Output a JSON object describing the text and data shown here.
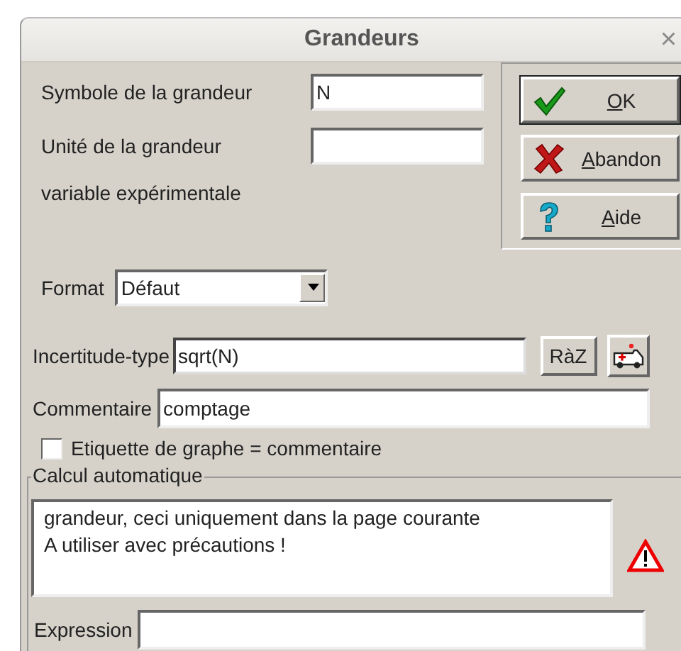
{
  "window": {
    "title": "Grandeurs",
    "close": "×"
  },
  "symbol": {
    "label": "Symbole de la grandeur",
    "value": "N"
  },
  "unit": {
    "label": "Unité de la grandeur"
  },
  "variable_kind": "variable expérimentale",
  "buttons": [
    {
      "kind": "ok",
      "key": "O",
      "rest": "K",
      "default": true
    },
    {
      "kind": "cancel",
      "key": "A",
      "rest": "bandon",
      "default": false
    },
    {
      "kind": "help",
      "key": "A",
      "rest": "ide",
      "default": false
    }
  ],
  "format": {
    "label": "Format",
    "value": "Défaut"
  },
  "uncertainty": {
    "label": "Incertitude-type",
    "value": "sqrt(N)",
    "focused": true,
    "reset_button": "RàZ"
  },
  "comment": {
    "label": "Commentaire",
    "value": "comptage"
  },
  "graph_label_checkbox": {
    "label": "Etiquette de graphe = commentaire",
    "checked": false
  },
  "auto_calc": {
    "title": "Calcul automatique",
    "lines": [
      "grandeur, ceci uniquement dans la page courante",
      "A utiliser avec précautions !"
    ],
    "expression_label": "Expression"
  }
}
